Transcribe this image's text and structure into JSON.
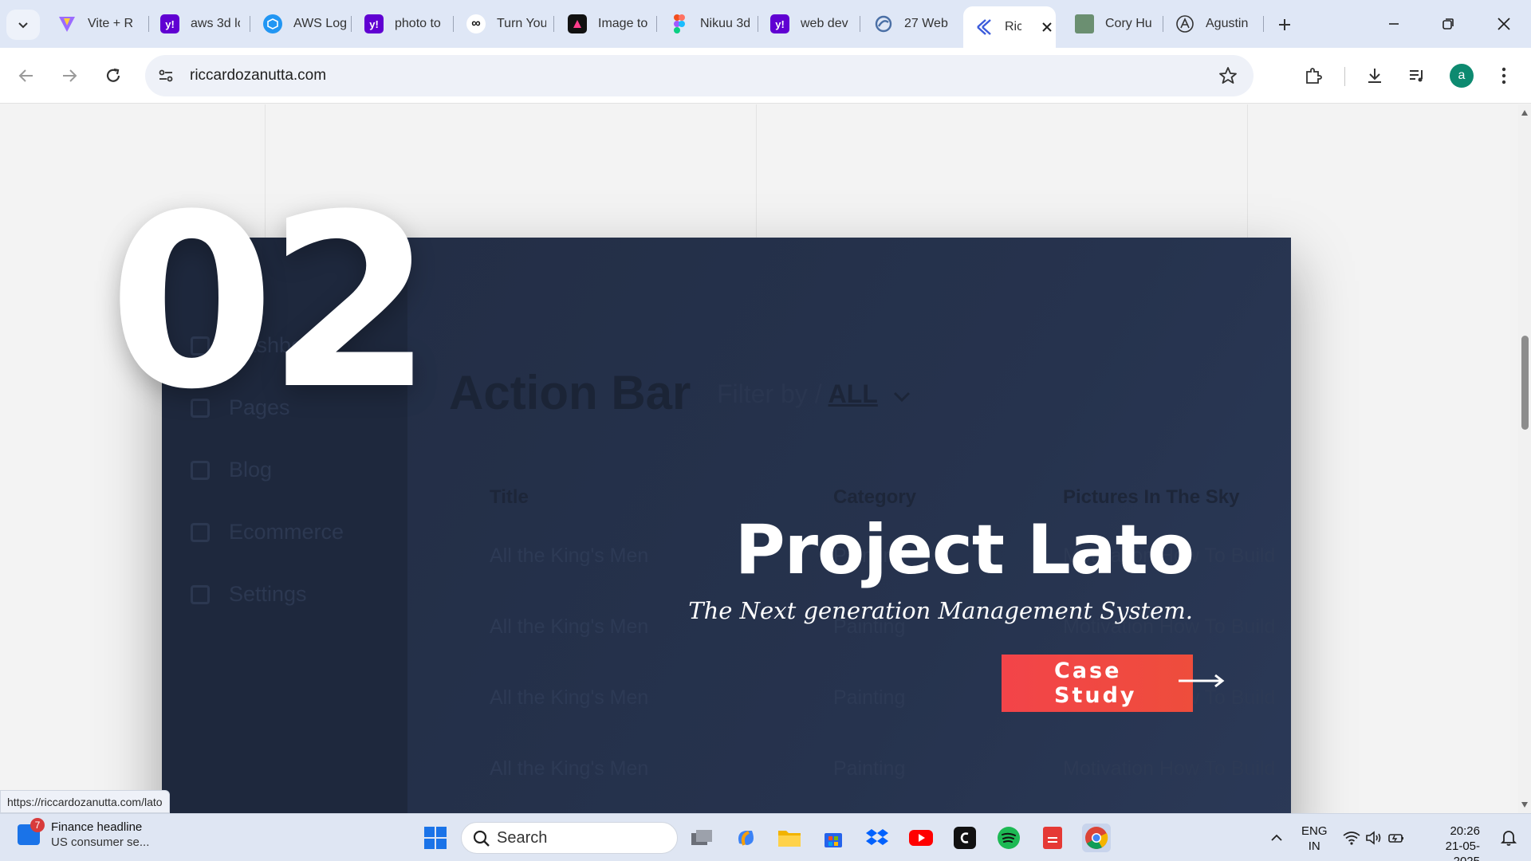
{
  "browser": {
    "tabs": [
      {
        "title": "Vite + R",
        "favicon_color": "#7c5cff"
      },
      {
        "title": "aws 3d lo",
        "favicon_color": "#6001d2"
      },
      {
        "title": "AWS Log",
        "favicon_color": "#2196f3"
      },
      {
        "title": "photo to",
        "favicon_color": "#6001d2"
      },
      {
        "title": "Turn You",
        "favicon_color": "#ffffff"
      },
      {
        "title": "Image to",
        "favicon_color": "#111111"
      },
      {
        "title": "Nikuu 3d",
        "favicon_color": "#f24e1e"
      },
      {
        "title": "web dev",
        "favicon_color": "#6001d2"
      },
      {
        "title": "27 Web",
        "favicon_color": "#4a6fa5"
      },
      {
        "title": "Ric",
        "favicon_color": "#3b5bdb",
        "active": true
      },
      {
        "title": "Cory Hu",
        "favicon_color": "#6b8f71"
      },
      {
        "title": "Agustin",
        "favicon_color": "#444444"
      }
    ],
    "favicon_glyphs": {
      "yahoo": "y!"
    },
    "address": "riccardozanutta.com",
    "profile_initial": "a",
    "status_url": "https://riccardozanutta.com/lato"
  },
  "page": {
    "project_number": "02",
    "project_title": "Project Lato",
    "project_subtitle": "The Next generation Management System.",
    "cta_label": "Case Study",
    "mock": {
      "sidebar_items": [
        "Dashboard",
        "Pages",
        "Blog",
        "Ecommerce",
        "Settings"
      ],
      "title": "Action Bar",
      "filter_label": "Filter by /",
      "filter_value": "ALL",
      "columns": [
        "Title",
        "Category",
        "Pictures In The Sky"
      ],
      "rows": [
        [
          "All the King's Men",
          "Painting",
          "Motivation How To Build"
        ],
        [
          "All the King's Men",
          "Painting",
          "Motivation How To Build"
        ],
        [
          "All the King's Men",
          "Painting",
          "Motivation How To Build"
        ],
        [
          "All the King's Men",
          "Painting",
          "Motivation How To Build"
        ]
      ]
    }
  },
  "taskbar": {
    "news_badge": "7",
    "news_title": "Finance headline",
    "news_sub": "US consumer se...",
    "search_label": "Search",
    "lang_top": "ENG",
    "lang_bottom": "IN",
    "time": "20:26",
    "date": "21-05-2025"
  },
  "colors": {
    "card": "#26324c",
    "cta": "#f34449",
    "tabstrip": "#dfe7f6"
  }
}
